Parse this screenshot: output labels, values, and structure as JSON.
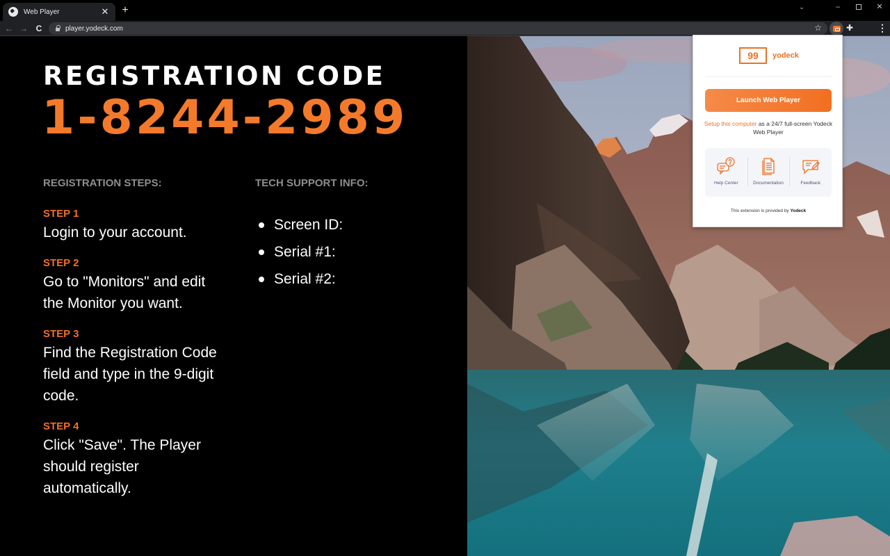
{
  "browser": {
    "tab_title": "Web Player",
    "url": "player.yodeck.com",
    "window_controls": {
      "dropdown": "⌄",
      "minimize": "–",
      "close": "✕"
    },
    "icons": {
      "back": "←",
      "forward": "→",
      "reload": "C",
      "star": "☆",
      "puzzle": "✚",
      "menu": "⋮",
      "new_tab": "+",
      "close_tab": "✕"
    }
  },
  "main": {
    "title": "REGISTRATION CODE",
    "code": "1-8244-2989",
    "code_color": "#f47a2b",
    "steps_heading": "REGISTRATION STEPS:",
    "steps": [
      {
        "label": "STEP 1",
        "text": "Login to your account."
      },
      {
        "label": "STEP 2",
        "text": "Go to \"Monitors\" and edit the Monitor you want."
      },
      {
        "label": "STEP 3",
        "text": "Find the Registration Code field and type in the 9-digit code."
      },
      {
        "label": "STEP 4",
        "text": "Click \"Save\". The Player should register automatically."
      }
    ],
    "support_heading": "TECH SUPPORT INFO:",
    "support_items": [
      "Screen ID:",
      "Serial #1:",
      "Serial #2:"
    ]
  },
  "extension_popup": {
    "brand": "yodeck",
    "logo_glyph": "99",
    "brand_color": "#f26f21",
    "launch_button": "Launch Web Player",
    "setup_link": "Setup this computer",
    "setup_text_rest": " as a 24/7 full-screen Yodeck Web Player",
    "links": [
      {
        "label": "Help Center",
        "icon": "help-chat-icon"
      },
      {
        "label": "Documentation",
        "icon": "document-icon"
      },
      {
        "label": "Feedback",
        "icon": "feedback-icon"
      }
    ],
    "footer_prefix": "This extension is provided by ",
    "footer_brand": "Yodeck"
  }
}
